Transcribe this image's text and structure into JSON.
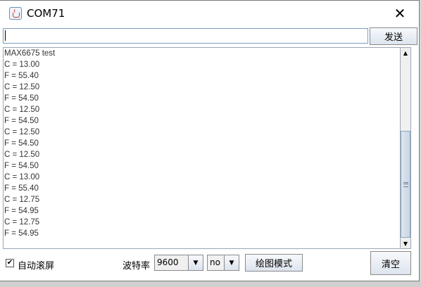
{
  "window": {
    "title": "COM71",
    "close_symbol": "✕"
  },
  "input_row": {
    "command_value": "",
    "send_label": "发送"
  },
  "output": {
    "lines": [
      "MAX6675 test",
      "C = 13.00",
      "F = 55.40",
      "C = 12.50",
      "F = 54.50",
      "C = 12.50",
      "F = 54.50",
      "C = 12.50",
      "F = 54.50",
      "C = 12.50",
      "F = 54.50",
      "C = 13.00",
      "F = 55.40",
      "C = 12.75",
      "F = 54.95",
      "C = 12.75",
      "F = 54.95"
    ]
  },
  "scrollbar": {
    "up_symbol": "▲",
    "down_symbol": "▼"
  },
  "status_bar": {
    "autoscroll": {
      "label": "自动滚屏",
      "checked_symbol": "✔"
    },
    "baud": {
      "label": "波特率",
      "value": "9600"
    },
    "line_ending": {
      "value": "no"
    },
    "dropdown_arrow": "▼",
    "plot_mode_label": "绘图模式",
    "clear_label": "清空"
  }
}
